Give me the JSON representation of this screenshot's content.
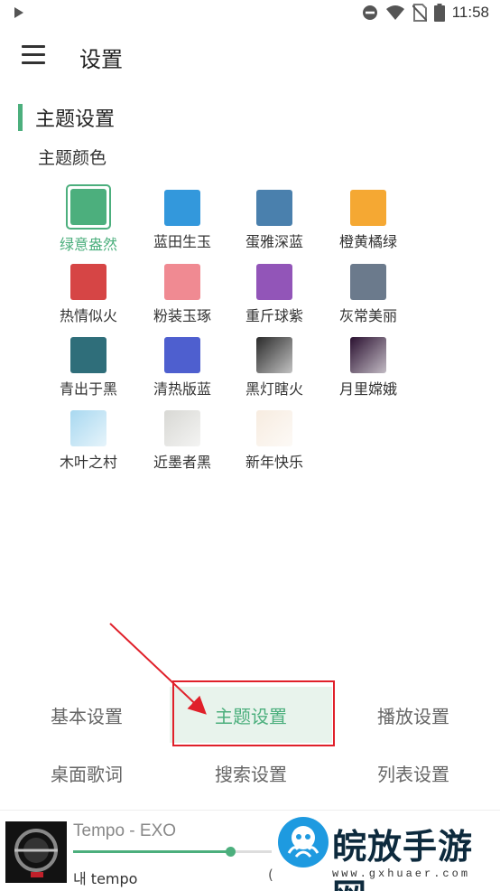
{
  "status_bar": {
    "time": "11:58",
    "icons": [
      "play-indicator-icon",
      "do-not-disturb-icon",
      "wifi-icon",
      "no-sim-icon",
      "battery-icon"
    ]
  },
  "toolbar": {
    "title": "设置",
    "menu_icon": "hamburger-menu-icon"
  },
  "section": {
    "title": "主题设置",
    "subtitle": "主题颜色",
    "accent_color": "#4caf7d"
  },
  "themes": [
    {
      "label": "绿意盎然",
      "color": "#4caf7d",
      "selected": true
    },
    {
      "label": "蓝田生玉",
      "color": "#3398dc"
    },
    {
      "label": "蛋雅深蓝",
      "color": "#4a80ad"
    },
    {
      "label": "橙黄橘绿",
      "color": "#f5a833"
    },
    {
      "label": "热情似火",
      "color": "#d64545"
    },
    {
      "label": "粉装玉琢",
      "color": "#f08a92"
    },
    {
      "label": "重斤球紫",
      "color": "#9255b8"
    },
    {
      "label": "灰常美丽",
      "color": "#6b7a8c"
    },
    {
      "label": "青出于黑",
      "color": "#2f6e7a"
    },
    {
      "label": "清热版蓝",
      "color": "#4e5fcf"
    },
    {
      "label": "黑灯瞎火",
      "color": "#2a2a2a",
      "image": true
    },
    {
      "label": "月里嫦娥",
      "color": "#2a1030",
      "image": true
    },
    {
      "label": "木叶之村",
      "color": "#a8d8f0",
      "image": true
    },
    {
      "label": "近墨者黑",
      "color": "#d8d8d4",
      "image": true
    },
    {
      "label": "新年快乐",
      "color": "#f7ece0",
      "image": true
    }
  ],
  "tabs": [
    {
      "label": "基本设置"
    },
    {
      "label": "主题设置",
      "active": true
    },
    {
      "label": "播放设置"
    },
    {
      "label": "桌面歌词"
    },
    {
      "label": "搜索设置"
    },
    {
      "label": "列表设置"
    }
  ],
  "player": {
    "title": "Tempo - EXO",
    "subtitle": "내 tempo",
    "time": "(",
    "progress": 0.79
  },
  "watermark": {
    "text": "皖放手游网",
    "url": "www.gxhuaer.com"
  }
}
